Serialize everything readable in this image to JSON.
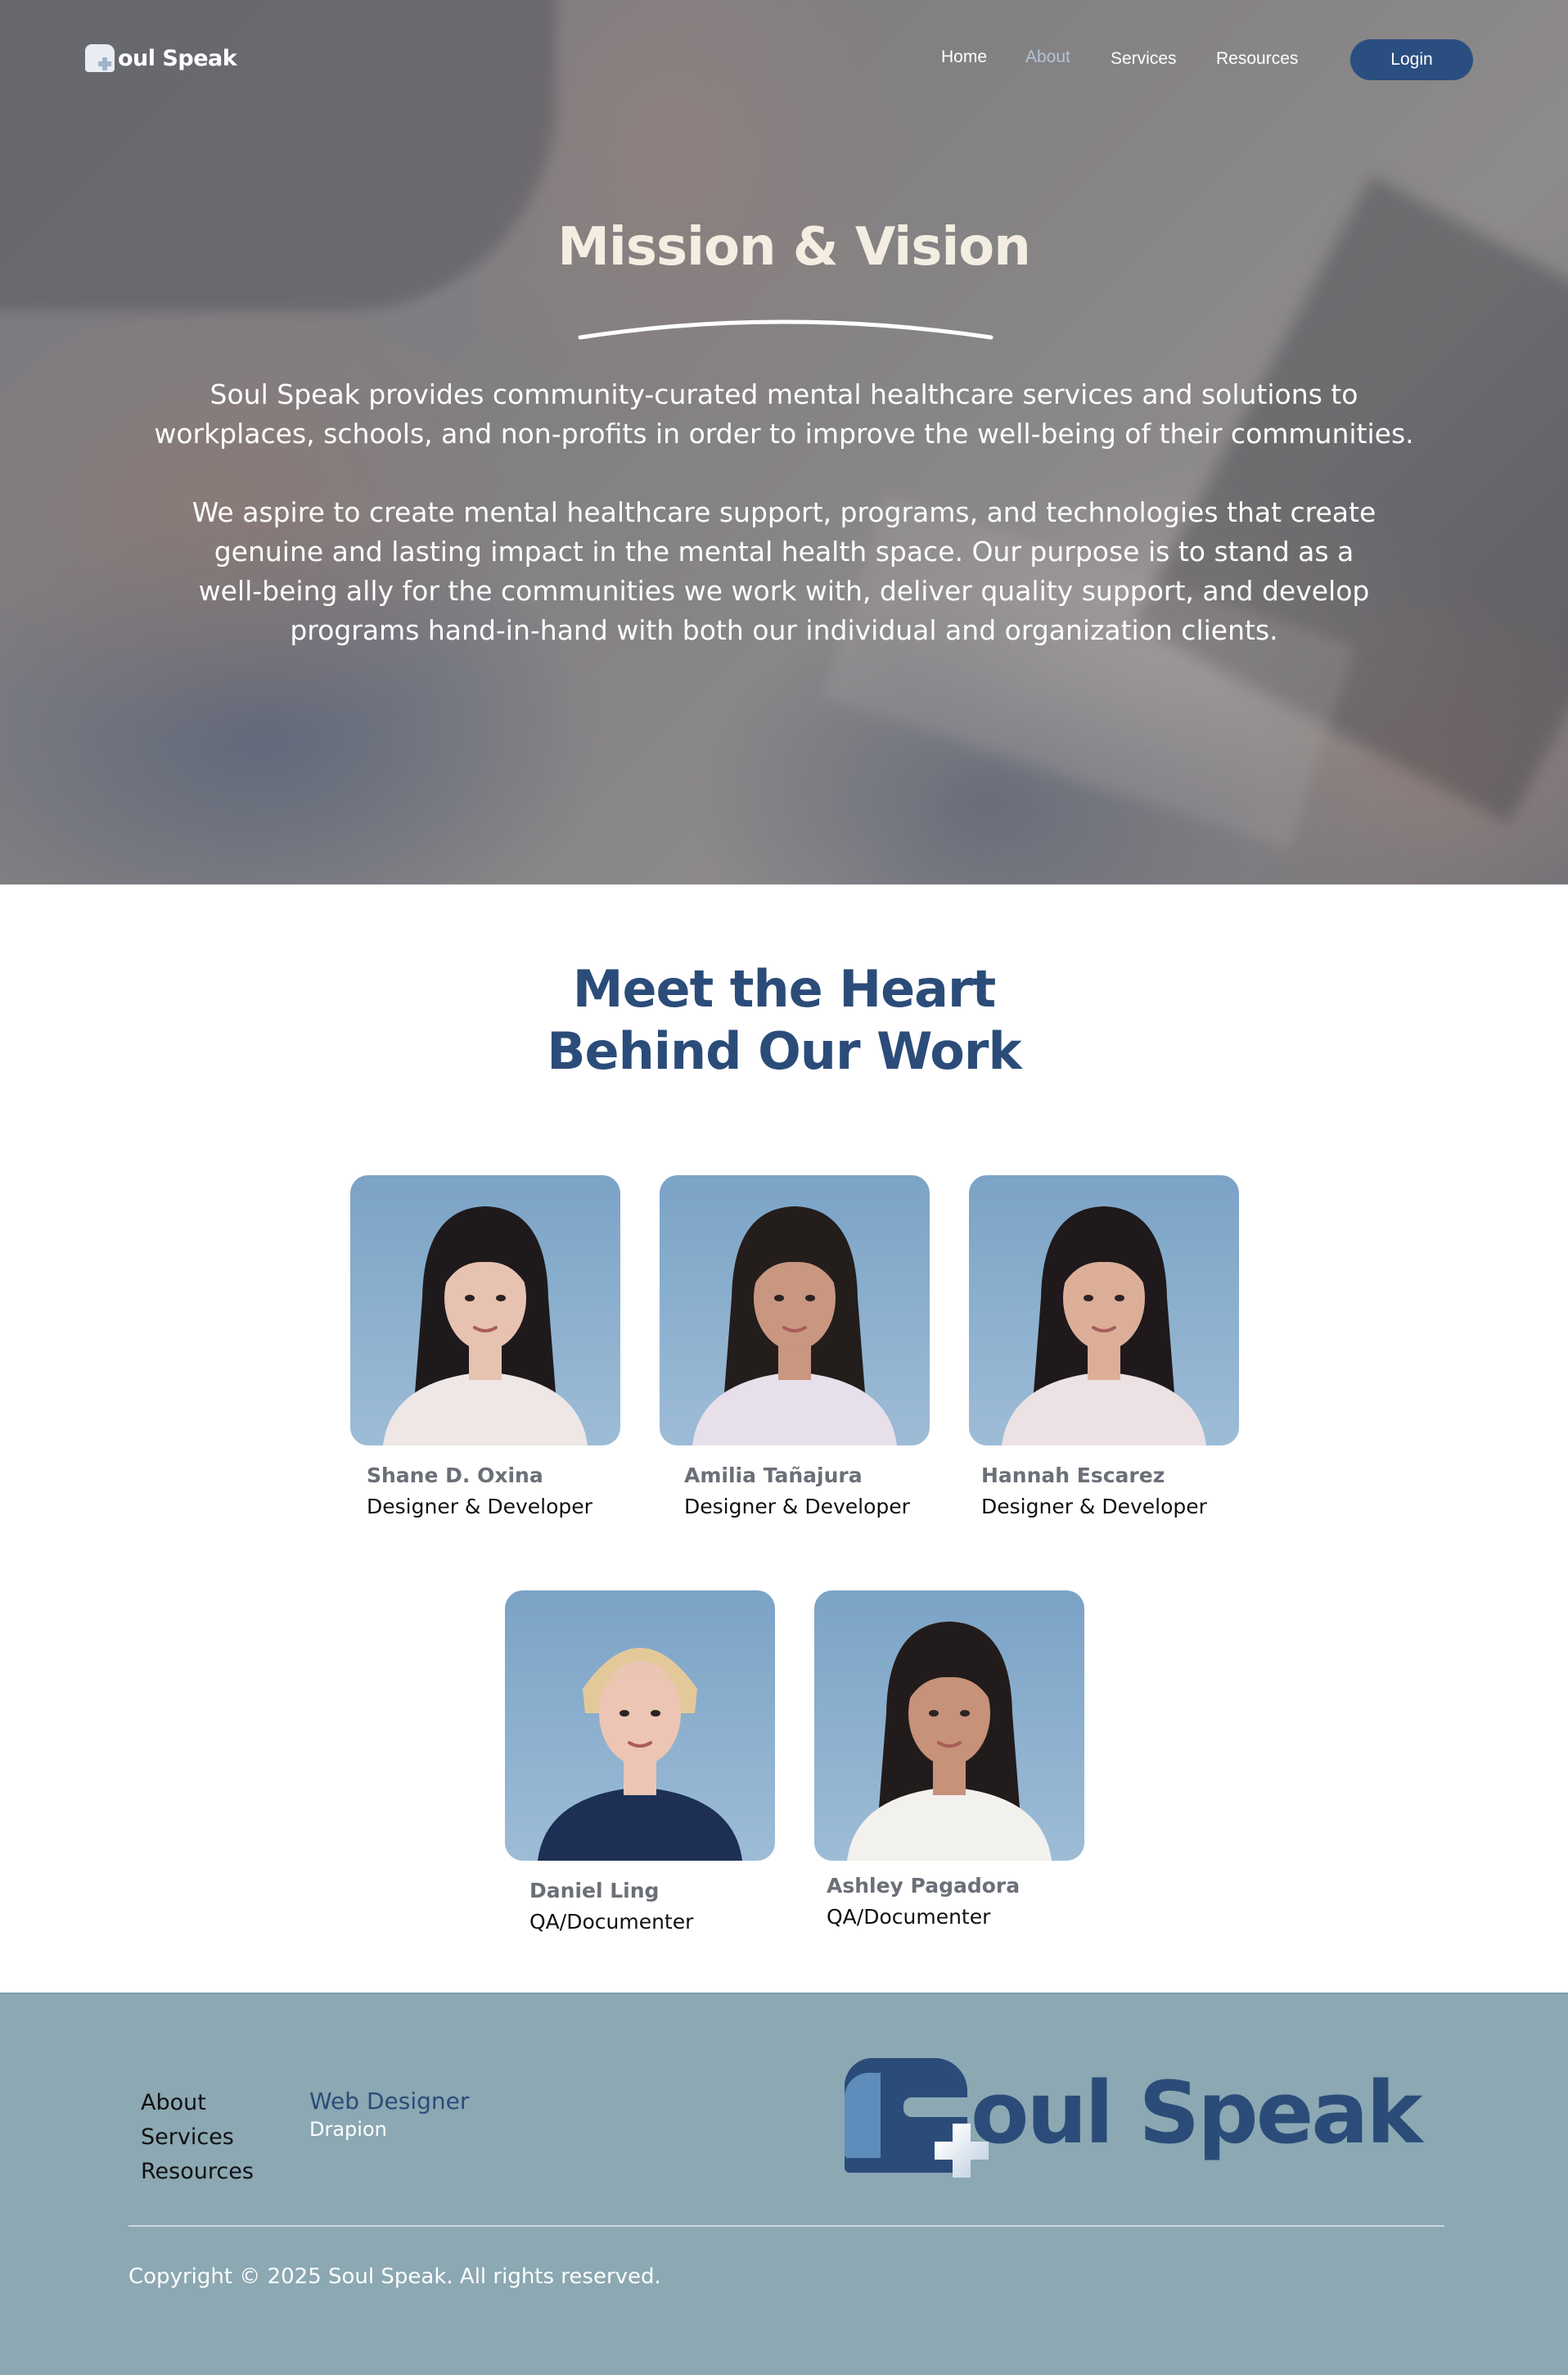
{
  "brand": {
    "name": "Soul Speak",
    "logo_text": "oul Speak",
    "colors": {
      "primary": "#2b4c79",
      "footer_bg": "#8ba8b3",
      "hero_title": "#f4ede2",
      "nav_active": "#b3c3d6"
    }
  },
  "nav": {
    "items": [
      {
        "label": "Home"
      },
      {
        "label": "About",
        "active": true
      },
      {
        "label": "Services"
      },
      {
        "label": "Resources"
      }
    ],
    "login_label": "Login"
  },
  "hero": {
    "title": "Mission & Vision",
    "paragraph_1": "Soul Speak provides community-curated mental healthcare services and solutions to workplaces, schools, and non-profits in order to improve the well-being of their communities.",
    "paragraph_2": "We aspire to create mental healthcare support, programs, and technologies that create genuine and lasting impact in the mental health space. Our purpose is to stand as a well-being ally for the communities we work with, deliver quality support, and develop programs hand-in-hand with both our individual and organization clients."
  },
  "team": {
    "title_line_1": "Meet the Heart",
    "title_line_2": "Behind Our Work",
    "members": [
      {
        "name": "Shane D. Oxina",
        "role": "Designer & Developer",
        "hair": "#1e1a1c",
        "shirt": "#efe6e6",
        "skin": "#e8c2b0"
      },
      {
        "name": "Amilia Tañajura",
        "role": "Designer & Developer",
        "hair": "#231d1c",
        "shirt": "#e7e0ea",
        "skin": "#c99680"
      },
      {
        "name": "Hannah Escarez",
        "role": "Designer & Developer",
        "hair": "#1f191b",
        "shirt": "#ece2e4",
        "skin": "#dcae98"
      },
      {
        "name": "Daniel Ling",
        "role": "QA/Documenter",
        "hair": "#e3c99a",
        "shirt": "#1d2f55",
        "skin": "#ecc5b4"
      },
      {
        "name": "Ashley Pagadora",
        "role": "QA/Documenter",
        "hair": "#221b1b",
        "shirt": "#f3f1ee",
        "skin": "#c69279"
      }
    ]
  },
  "footer": {
    "links": [
      {
        "label": "About"
      },
      {
        "label": "Services"
      },
      {
        "label": "Resources"
      }
    ],
    "credit_role": "Web Designer",
    "credit_name": "Drapion",
    "logo_text": "oul Speak",
    "copyright": "Copyright © 2025 Soul Speak. All rights reserved."
  }
}
